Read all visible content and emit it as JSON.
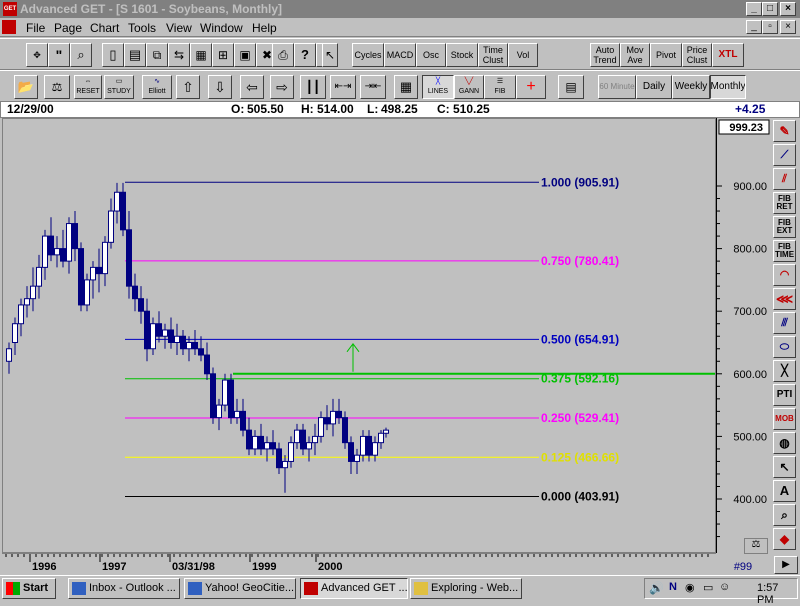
{
  "window": {
    "title": "Advanced GET - [S 1601 - Soybeans, Monthly]",
    "app_icon": "GET"
  },
  "menu": [
    "File",
    "Page",
    "Chart",
    "Tools",
    "View",
    "Window",
    "Help"
  ],
  "toolbar1": {
    "study_buttons": [
      "Cycles",
      "MACD",
      "Osc",
      "Stock",
      "Time Clust",
      "Vol"
    ],
    "right_buttons": [
      "Auto Trend",
      "Mov Ave",
      "Pivot",
      "Price Clust",
      "XTL"
    ]
  },
  "toolbar2": {
    "labels": {
      "reset": "RESET",
      "study": "STUDY",
      "elliott": "Elliott",
      "lines": "LINES",
      "gann": "GANN",
      "fib": "FIB"
    },
    "timeframes": [
      "60 Minute",
      "Daily",
      "Weekly",
      "Monthly"
    ],
    "active_timeframe": "Monthly"
  },
  "info": {
    "date": "12/29/00",
    "open_label": "O:",
    "open": "505.50",
    "high_label": "H:",
    "high": "514.00",
    "low_label": "L:",
    "low": "498.25",
    "close_label": "C:",
    "close": "510.25",
    "change": "+4.25"
  },
  "chart": {
    "axis_top_label": "999.23",
    "y_ticks": [
      {
        "value": 900,
        "label": "900.00"
      },
      {
        "value": 800,
        "label": "800.00"
      },
      {
        "value": 700,
        "label": "700.00"
      },
      {
        "value": 600,
        "label": "600.00"
      },
      {
        "value": 500,
        "label": "500.00"
      },
      {
        "value": 400,
        "label": "400.00"
      }
    ],
    "fib_levels": [
      {
        "ratio": "1.000",
        "value": 905.91,
        "label": "1.000 (905.91)",
        "color": "#000080"
      },
      {
        "ratio": "0.750",
        "value": 780.41,
        "label": "0.750 (780.41)",
        "color": "#ff00ff"
      },
      {
        "ratio": "0.500",
        "value": 654.91,
        "label": "0.500 (654.91)",
        "color": "#0000c0"
      },
      {
        "ratio": "0.375",
        "value": 592.16,
        "label": "0.375 (592.16)",
        "color": "#00c000"
      },
      {
        "ratio": "0.250",
        "value": 529.41,
        "label": "0.250 (529.41)",
        "color": "#ff00ff"
      },
      {
        "ratio": "0.125",
        "value": 466.66,
        "label": "0.125 (466.66)",
        "color": "#ffff00"
      },
      {
        "ratio": "0.000",
        "value": 403.91,
        "label": "0.000 (403.91)",
        "color": "#000000"
      }
    ],
    "horizontal_line_value": 600,
    "colors": {
      "candle": "#000080",
      "background": "#c0c0c0"
    },
    "x_labels": [
      "1996",
      "1997",
      "03/31/98",
      "1999",
      "2000"
    ],
    "corner_label": "#99"
  },
  "right_panel": [
    "FIB RET",
    "FIB EXT",
    "FIB TIME",
    "PTI",
    "MOB"
  ],
  "taskbar": {
    "start": "Start",
    "tasks": [
      "Inbox - Outlook ...",
      "Yahoo! GeoCitie...",
      "Advanced GET ...",
      "Exploring - Web..."
    ],
    "active_task": "Advanced GET ...",
    "clock": "1:57 PM"
  }
}
